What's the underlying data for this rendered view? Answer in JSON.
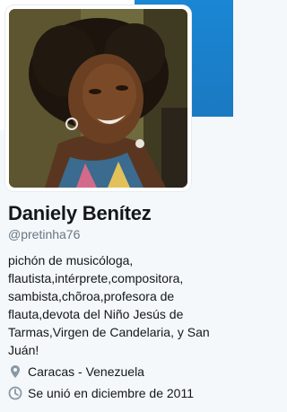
{
  "profile": {
    "name": "Daniely Benítez",
    "handle": "@pretinha76",
    "bio_lines": [
      "pichón de musicóloga,",
      "flautista,intérprete,compositora,",
      "sambista,chõroa,profesora de",
      "flauta,devota del Niño Jesús de",
      "Tarmas,Virgen de Candelaria, y San",
      "Juán!"
    ],
    "location": "Caracas - Venezuela",
    "joined": "Se unió en diciembre de 2011"
  },
  "icons": {
    "location": "location-pin-icon",
    "joined": "clock-icon"
  },
  "colors": {
    "banner_blue": "#1b79c2",
    "icon_gray": "#8899a6",
    "handle_gray": "#657786"
  }
}
